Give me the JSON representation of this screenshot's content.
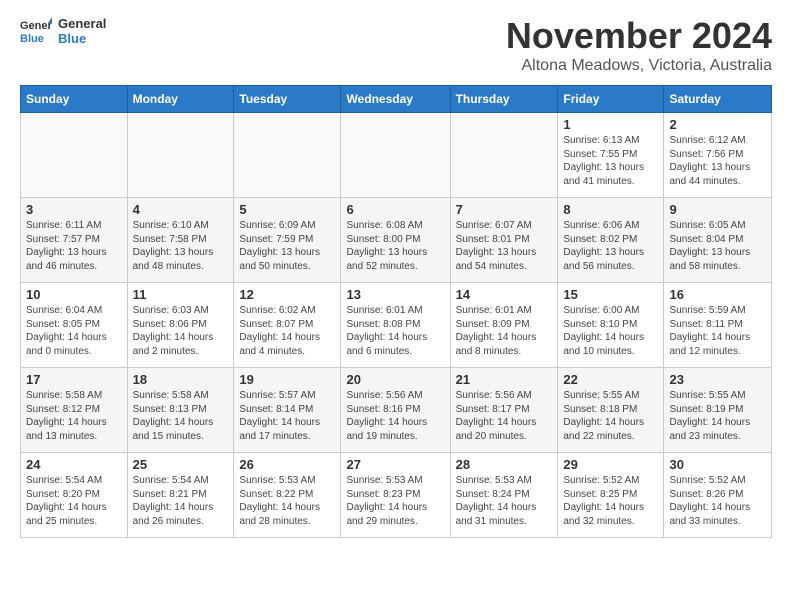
{
  "logo": {
    "general": "General",
    "blue": "Blue"
  },
  "header": {
    "title": "November 2024",
    "subtitle": "Altona Meadows, Victoria, Australia"
  },
  "weekdays": [
    "Sunday",
    "Monday",
    "Tuesday",
    "Wednesday",
    "Thursday",
    "Friday",
    "Saturday"
  ],
  "weeks": [
    [
      {
        "day": "",
        "info": ""
      },
      {
        "day": "",
        "info": ""
      },
      {
        "day": "",
        "info": ""
      },
      {
        "day": "",
        "info": ""
      },
      {
        "day": "",
        "info": ""
      },
      {
        "day": "1",
        "info": "Sunrise: 6:13 AM\nSunset: 7:55 PM\nDaylight: 13 hours\nand 41 minutes."
      },
      {
        "day": "2",
        "info": "Sunrise: 6:12 AM\nSunset: 7:56 PM\nDaylight: 13 hours\nand 44 minutes."
      }
    ],
    [
      {
        "day": "3",
        "info": "Sunrise: 6:11 AM\nSunset: 7:57 PM\nDaylight: 13 hours\nand 46 minutes."
      },
      {
        "day": "4",
        "info": "Sunrise: 6:10 AM\nSunset: 7:58 PM\nDaylight: 13 hours\nand 48 minutes."
      },
      {
        "day": "5",
        "info": "Sunrise: 6:09 AM\nSunset: 7:59 PM\nDaylight: 13 hours\nand 50 minutes."
      },
      {
        "day": "6",
        "info": "Sunrise: 6:08 AM\nSunset: 8:00 PM\nDaylight: 13 hours\nand 52 minutes."
      },
      {
        "day": "7",
        "info": "Sunrise: 6:07 AM\nSunset: 8:01 PM\nDaylight: 13 hours\nand 54 minutes."
      },
      {
        "day": "8",
        "info": "Sunrise: 6:06 AM\nSunset: 8:02 PM\nDaylight: 13 hours\nand 56 minutes."
      },
      {
        "day": "9",
        "info": "Sunrise: 6:05 AM\nSunset: 8:04 PM\nDaylight: 13 hours\nand 58 minutes."
      }
    ],
    [
      {
        "day": "10",
        "info": "Sunrise: 6:04 AM\nSunset: 8:05 PM\nDaylight: 14 hours\nand 0 minutes."
      },
      {
        "day": "11",
        "info": "Sunrise: 6:03 AM\nSunset: 8:06 PM\nDaylight: 14 hours\nand 2 minutes."
      },
      {
        "day": "12",
        "info": "Sunrise: 6:02 AM\nSunset: 8:07 PM\nDaylight: 14 hours\nand 4 minutes."
      },
      {
        "day": "13",
        "info": "Sunrise: 6:01 AM\nSunset: 8:08 PM\nDaylight: 14 hours\nand 6 minutes."
      },
      {
        "day": "14",
        "info": "Sunrise: 6:01 AM\nSunset: 8:09 PM\nDaylight: 14 hours\nand 8 minutes."
      },
      {
        "day": "15",
        "info": "Sunrise: 6:00 AM\nSunset: 8:10 PM\nDaylight: 14 hours\nand 10 minutes."
      },
      {
        "day": "16",
        "info": "Sunrise: 5:59 AM\nSunset: 8:11 PM\nDaylight: 14 hours\nand 12 minutes."
      }
    ],
    [
      {
        "day": "17",
        "info": "Sunrise: 5:58 AM\nSunset: 8:12 PM\nDaylight: 14 hours\nand 13 minutes."
      },
      {
        "day": "18",
        "info": "Sunrise: 5:58 AM\nSunset: 8:13 PM\nDaylight: 14 hours\nand 15 minutes."
      },
      {
        "day": "19",
        "info": "Sunrise: 5:57 AM\nSunset: 8:14 PM\nDaylight: 14 hours\nand 17 minutes."
      },
      {
        "day": "20",
        "info": "Sunrise: 5:56 AM\nSunset: 8:16 PM\nDaylight: 14 hours\nand 19 minutes."
      },
      {
        "day": "21",
        "info": "Sunrise: 5:56 AM\nSunset: 8:17 PM\nDaylight: 14 hours\nand 20 minutes."
      },
      {
        "day": "22",
        "info": "Sunrise: 5:55 AM\nSunset: 8:18 PM\nDaylight: 14 hours\nand 22 minutes."
      },
      {
        "day": "23",
        "info": "Sunrise: 5:55 AM\nSunset: 8:19 PM\nDaylight: 14 hours\nand 23 minutes."
      }
    ],
    [
      {
        "day": "24",
        "info": "Sunrise: 5:54 AM\nSunset: 8:20 PM\nDaylight: 14 hours\nand 25 minutes."
      },
      {
        "day": "25",
        "info": "Sunrise: 5:54 AM\nSunset: 8:21 PM\nDaylight: 14 hours\nand 26 minutes."
      },
      {
        "day": "26",
        "info": "Sunrise: 5:53 AM\nSunset: 8:22 PM\nDaylight: 14 hours\nand 28 minutes."
      },
      {
        "day": "27",
        "info": "Sunrise: 5:53 AM\nSunset: 8:23 PM\nDaylight: 14 hours\nand 29 minutes."
      },
      {
        "day": "28",
        "info": "Sunrise: 5:53 AM\nSunset: 8:24 PM\nDaylight: 14 hours\nand 31 minutes."
      },
      {
        "day": "29",
        "info": "Sunrise: 5:52 AM\nSunset: 8:25 PM\nDaylight: 14 hours\nand 32 minutes."
      },
      {
        "day": "30",
        "info": "Sunrise: 5:52 AM\nSunset: 8:26 PM\nDaylight: 14 hours\nand 33 minutes."
      }
    ]
  ]
}
